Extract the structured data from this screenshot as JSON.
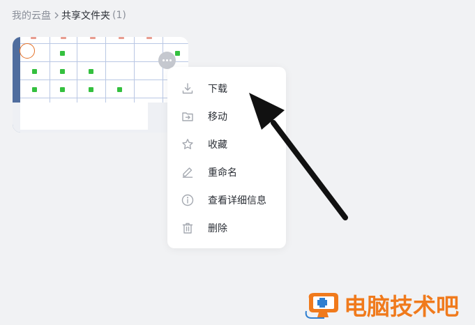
{
  "breadcrumb": {
    "root": "我的云盘",
    "current": "共享文件夹",
    "count": "(1)"
  },
  "file_card": {
    "more_icon": "more-horizontal-icon",
    "select_icon": "select-circle-icon"
  },
  "context_menu": {
    "items": [
      {
        "label": "下载",
        "icon": "download-icon"
      },
      {
        "label": "移动",
        "icon": "move-folder-icon"
      },
      {
        "label": "收藏",
        "icon": "star-icon"
      },
      {
        "label": "重命名",
        "icon": "pencil-icon"
      },
      {
        "label": "查看详细信息",
        "icon": "info-icon"
      },
      {
        "label": "删除",
        "icon": "trash-icon"
      }
    ]
  },
  "annotation": {
    "type": "arrow",
    "color": "#111111"
  },
  "watermark": {
    "text": "电脑技术吧",
    "color": "#f07a1c"
  },
  "colors": {
    "background": "#f1f2f4",
    "accent_orange": "#e46f25",
    "card_strip": "#4f6d9e"
  }
}
